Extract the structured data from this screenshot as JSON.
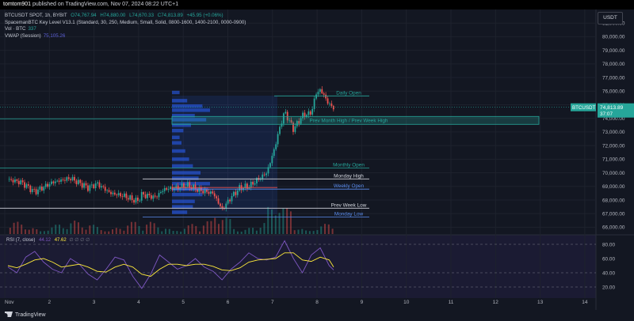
{
  "header": {
    "author": "tomtom901",
    "text": "published on TradingView.com, Nov 07, 2024 08:22 UTC+1"
  },
  "legend": {
    "symbol": "BTCUSDT SPOT, 1h, BYBIT",
    "open": "O74,767.94",
    "high": "H74,880.00",
    "low": "L74,670.33",
    "close": "C74,813.89",
    "change": "+45.95 (+0.06%)",
    "indicator": "SpacemanBTC Key Level V13.1 (Standard, 30, 250, Medium, Small, Solid, 0800-1600, 1400-2100, 0000-0900)",
    "vol_label": "Vol · BTC",
    "vol_value": "337",
    "vwap_label": "VWAP (Session)",
    "vwap_value": "75,105.26"
  },
  "currency_button": "USDT",
  "footer": {
    "brand": "TradingView"
  },
  "colors": {
    "up": "#26a69a",
    "down": "#ef5350",
    "level_teal": "#26a69a",
    "level_blue": "#5b8def",
    "level_white": "#d1d4dc",
    "profile": "#2962ff",
    "rsi": "#7e57c2",
    "rsi_ma": "#ffeb3b"
  },
  "price_badge": {
    "symbol": "BTCUSDT",
    "price": "74,813.89",
    "countdown": "37:07"
  },
  "chart_data": [
    {
      "type": "candlestick",
      "title": "BTCUSDT SPOT, 1h, BYBIT",
      "ylim": [
        65500,
        82000
      ],
      "x_ticks": [
        "Nov",
        "2",
        "3",
        "4",
        "5",
        "6",
        "7",
        "8",
        "9",
        "10",
        "11",
        "12",
        "13",
        "14"
      ],
      "y_ticks": [
        "66,000.00",
        "67,000.00",
        "68,000.00",
        "69,000.00",
        "70,000.00",
        "71,000.00",
        "72,000.00",
        "73,000.00",
        "74,000.00",
        "75,000.00",
        "76,000.00",
        "77,000.00",
        "78,000.00",
        "79,000.00",
        "80,000.00",
        "81,000.00"
      ],
      "price_path": {
        "days": [
          0,
          0.3,
          0.6,
          1.0,
          1.4,
          1.8,
          2.0,
          2.3,
          2.6,
          2.9,
          3.0,
          3.3,
          3.5,
          3.8,
          4.0,
          4.3,
          4.6,
          4.8,
          5.0,
          5.2,
          5.4,
          5.6,
          5.8,
          5.95,
          6.1,
          6.2,
          6.4,
          6.6,
          6.8,
          6.9,
          7.0,
          7.1,
          7.2,
          7.3
        ],
        "values": [
          69500,
          69300,
          68600,
          69300,
          69600,
          68900,
          69200,
          68500,
          68300,
          67900,
          68400,
          68200,
          68800,
          68900,
          69100,
          68700,
          68500,
          67300,
          68200,
          68900,
          69000,
          69500,
          70000,
          71500,
          73400,
          74500,
          73200,
          74200,
          74400,
          75800,
          76100,
          75600,
          75000,
          74814
        ]
      },
      "key_levels": [
        {
          "label": "Daily Open",
          "value": 75650
        },
        {
          "label": "Prev Month High / Prev Week High",
          "value": 73850
        },
        {
          "label": "Monthly Open",
          "value": 70350
        },
        {
          "label": "Monday High",
          "value": 69550
        },
        {
          "label": "Weekly Open",
          "value": 68800
        },
        {
          "label": "Prev Week Low",
          "value": 67400
        },
        {
          "label": "Monday Low",
          "value": 66750
        }
      ],
      "last_price": 74813.89
    },
    {
      "type": "line",
      "title": "RSI (7, close)",
      "series": [
        {
          "name": "RSI",
          "value": 44.12
        },
        {
          "name": "RSI MA",
          "value": 47.62
        }
      ],
      "y_ticks": [
        "20.00",
        "40.00",
        "60.00",
        "80.00"
      ],
      "ylim": [
        10,
        90
      ],
      "path": {
        "days": [
          0,
          0.2,
          0.4,
          0.6,
          0.8,
          1.0,
          1.2,
          1.4,
          1.6,
          1.8,
          2.0,
          2.2,
          2.4,
          2.6,
          2.8,
          3.0,
          3.2,
          3.4,
          3.6,
          3.8,
          4.0,
          4.2,
          4.4,
          4.6,
          4.8,
          5.0,
          5.2,
          5.4,
          5.6,
          5.8,
          6.0,
          6.2,
          6.4,
          6.6,
          6.8,
          7.0,
          7.2,
          7.3
        ],
        "rsi": [
          48,
          40,
          62,
          70,
          55,
          45,
          40,
          60,
          52,
          38,
          30,
          45,
          62,
          58,
          35,
          18,
          38,
          65,
          55,
          45,
          50,
          60,
          48,
          42,
          30,
          45,
          55,
          68,
          60,
          58,
          62,
          85,
          60,
          40,
          65,
          75,
          50,
          44
        ],
        "ma": [
          50,
          47,
          52,
          58,
          60,
          55,
          48,
          50,
          52,
          48,
          42,
          41,
          48,
          52,
          48,
          38,
          35,
          45,
          52,
          52,
          50,
          52,
          52,
          49,
          44,
          43,
          47,
          55,
          58,
          59,
          60,
          68,
          68,
          58,
          56,
          62,
          58,
          48
        ]
      }
    }
  ]
}
